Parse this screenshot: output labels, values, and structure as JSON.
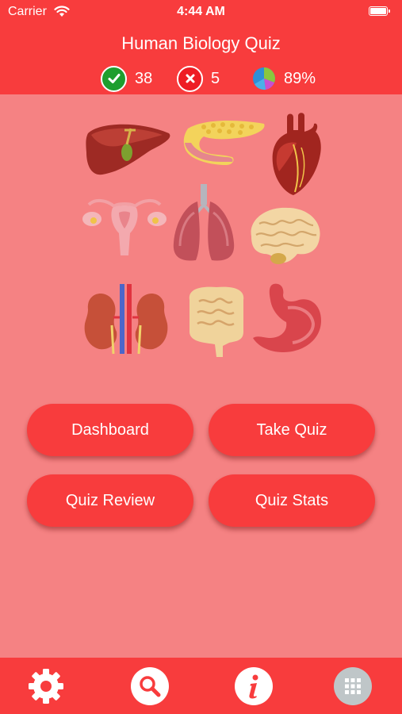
{
  "status_bar": {
    "carrier": "Carrier",
    "time": "4:44 AM"
  },
  "header": {
    "title": "Human Biology Quiz"
  },
  "stats": {
    "correct": "38",
    "wrong": "5",
    "score": "89%"
  },
  "buttons": {
    "dashboard": "Dashboard",
    "take_quiz": "Take Quiz",
    "quiz_review": "Quiz Review",
    "quiz_stats": "Quiz Stats"
  },
  "organs": [
    "liver",
    "pancreas",
    "heart",
    "uterus",
    "lungs",
    "brain",
    "kidneys",
    "intestines",
    "stomach"
  ],
  "tabbar": [
    "settings-icon",
    "search-icon",
    "info-icon",
    "grid-icon"
  ],
  "colors": {
    "primary": "#f83c3d",
    "background": "#f58283",
    "correct": "#1e9e2e",
    "wrong": "#ee1c24"
  }
}
